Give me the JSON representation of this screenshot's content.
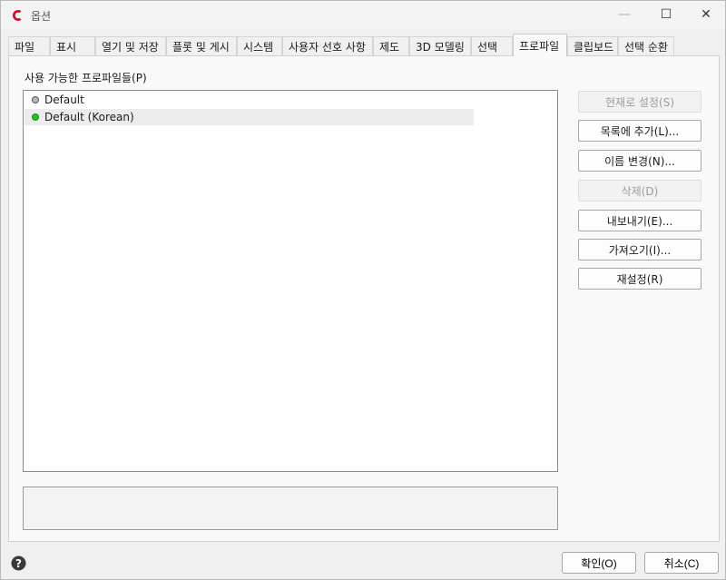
{
  "window": {
    "title": "옵션",
    "controls": {
      "minimize": "—",
      "maximize": "☐",
      "close": "✕"
    }
  },
  "tabs": [
    {
      "label": "파일"
    },
    {
      "label": "표시"
    },
    {
      "label": "열기 및 저장"
    },
    {
      "label": "플롯 및 게시"
    },
    {
      "label": "시스템"
    },
    {
      "label": "사용자 선호 사항"
    },
    {
      "label": "제도"
    },
    {
      "label": "3D 모델링"
    },
    {
      "label": "선택"
    },
    {
      "label": "프로파일",
      "active": true
    },
    {
      "label": "클립보드"
    },
    {
      "label": "선택 순환"
    }
  ],
  "profiles": {
    "label": "사용 가능한 프로파일들(P)",
    "items": [
      {
        "name": "Default",
        "status_color": "#b8b8b8"
      },
      {
        "name": "Default (Korean)",
        "status_color": "#22c022",
        "selected": true
      }
    ]
  },
  "buttons": {
    "set_current": "현재로 설정(S)",
    "add_to_list": "목록에 추가(L)...",
    "rename": "이름 변경(N)...",
    "delete": "삭제(D)",
    "export": "내보내기(E)...",
    "import": "가져오기(I)...",
    "reset": "재설정(R)"
  },
  "footer": {
    "ok": "확인(O)",
    "cancel": "취소(C)"
  },
  "colors": {
    "accent_logo": "#c8102e",
    "current_profile": "#22c022"
  }
}
